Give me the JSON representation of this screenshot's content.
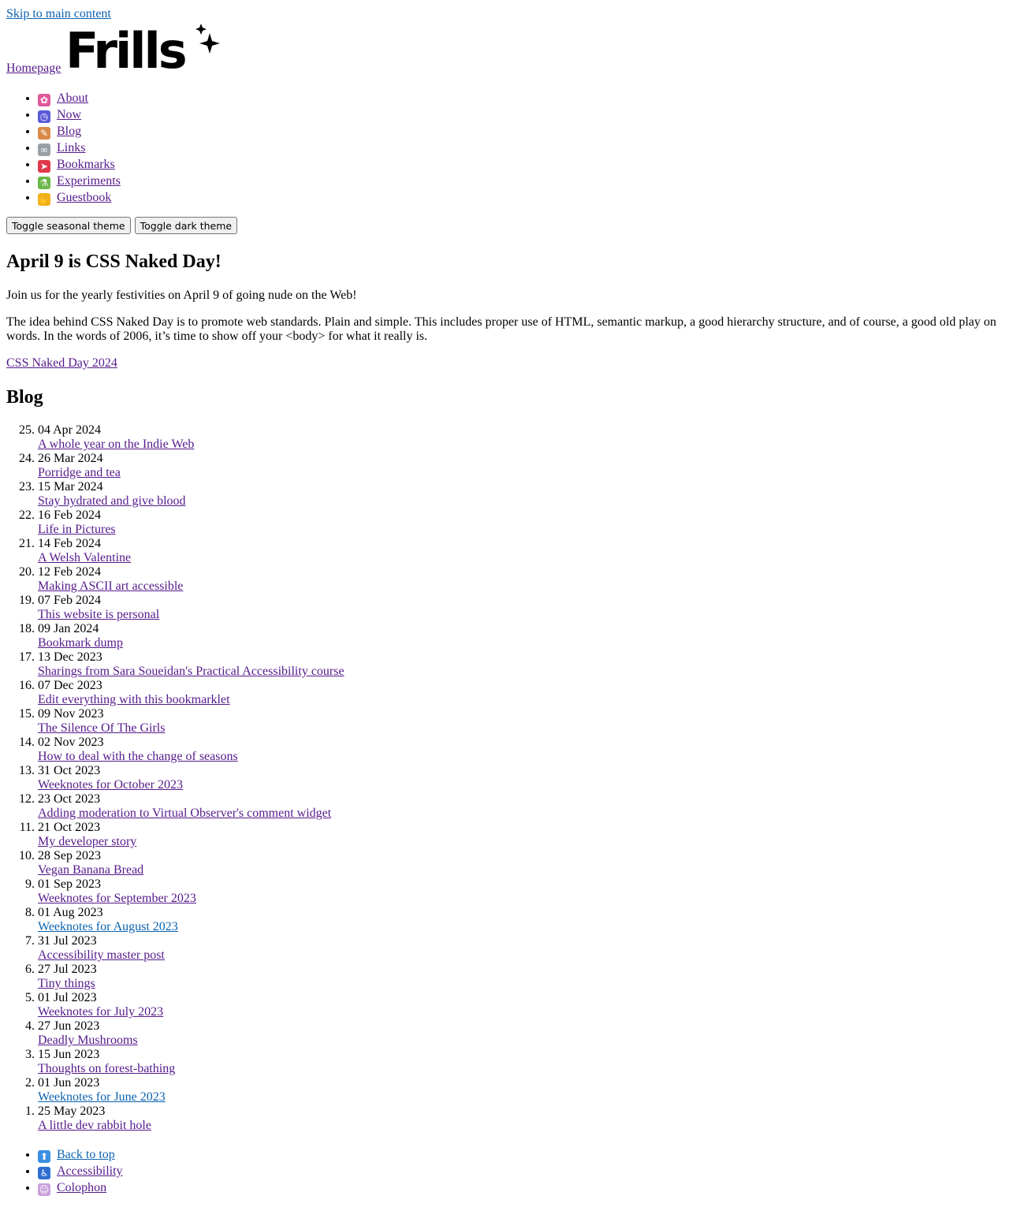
{
  "skip_link": "Skip to main content",
  "home_link": "Homepage",
  "logo_text": "Frills",
  "nav": [
    {
      "label": "About",
      "icon": "tulip-icon",
      "color": "#e05a9b",
      "glyph": "✿"
    },
    {
      "label": "Now",
      "icon": "stopwatch-icon",
      "color": "#5a5ad8",
      "glyph": "◷"
    },
    {
      "label": "Blog",
      "icon": "memo-icon",
      "color": "#d98a4a",
      "glyph": "✎"
    },
    {
      "label": "Links",
      "icon": "link-icon",
      "color": "#9aa0a8",
      "glyph": "∞"
    },
    {
      "label": "Bookmarks",
      "icon": "bookmark-tag-icon",
      "color": "#e0394a",
      "glyph": "➤"
    },
    {
      "label": "Experiments",
      "icon": "test-tube-icon",
      "color": "#6bb84a",
      "glyph": "⚗"
    },
    {
      "label": "Guestbook",
      "icon": "waving-hand-icon",
      "color": "#f1b21a",
      "glyph": "✋"
    }
  ],
  "buttons": {
    "seasonal": "Toggle seasonal theme",
    "dark": "Toggle dark theme"
  },
  "naked_day": {
    "title": "April 9 is CSS Naked Day!",
    "p1": "Join us for the yearly festivities on April 9 of going nude on the Web!",
    "p2": "The idea behind CSS Naked Day is to promote web standards. Plain and simple. This includes proper use of HTML, semantic markup, a good hierarchy structure, and of course, a good old play on words. In the words of 2006, it’s time to show off your <body> for what it really is.",
    "link": "CSS Naked Day 2024"
  },
  "blog": {
    "title": "Blog",
    "posts": [
      {
        "date": "04 Apr 2024",
        "title": "A whole year on the Indie Web"
      },
      {
        "date": "26 Mar 2024",
        "title": "Porridge and tea"
      },
      {
        "date": "15 Mar 2024",
        "title": "Stay hydrated and give blood"
      },
      {
        "date": "16 Feb 2024",
        "title": "Life in Pictures"
      },
      {
        "date": "14 Feb 2024",
        "title": "A Welsh Valentine"
      },
      {
        "date": "12 Feb 2024",
        "title": "Making ASCII art accessible"
      },
      {
        "date": "07 Feb 2024",
        "title": "This website is personal"
      },
      {
        "date": "09 Jan 2024",
        "title": "Bookmark dump"
      },
      {
        "date": "13 Dec 2023",
        "title": "Sharings from Sara Soueidan's Practical Accessibility course"
      },
      {
        "date": "07 Dec 2023",
        "title": "Edit everything with this bookmarklet"
      },
      {
        "date": "09 Nov 2023",
        "title": "The Silence Of The Girls"
      },
      {
        "date": "02 Nov 2023",
        "title": "How to deal with the change of seasons"
      },
      {
        "date": "31 Oct 2023",
        "title": "Weeknotes for October 2023"
      },
      {
        "date": "23 Oct 2023",
        "title": "Adding moderation to Virtual Observer's comment widget"
      },
      {
        "date": "21 Oct 2023",
        "title": "My developer story"
      },
      {
        "date": "28 Sep 2023",
        "title": "Vegan Banana Bread"
      },
      {
        "date": "01 Sep 2023",
        "title": "Weeknotes for September 2023"
      },
      {
        "date": "01 Aug 2023",
        "title": "Weeknotes for August 2023"
      },
      {
        "date": "31 Jul 2023",
        "title": "Accessibility master post"
      },
      {
        "date": "27 Jul 2023",
        "title": "Tiny things"
      },
      {
        "date": "01 Jul 2023",
        "title": "Weeknotes for July 2023"
      },
      {
        "date": "27 Jun 2023",
        "title": "Deadly Mushrooms"
      },
      {
        "date": "15 Jun 2023",
        "title": "Thoughts on forest-bathing"
      },
      {
        "date": "01 Jun 2023",
        "title": "Weeknotes for June 2023"
      },
      {
        "date": "25 May 2023",
        "title": "A little dev rabbit hole"
      }
    ]
  },
  "footer": [
    {
      "label": "Back to top",
      "icon": "up-arrow-icon",
      "color": "#3b8fe0",
      "glyph": "⬆"
    },
    {
      "label": "Accessibility",
      "icon": "wheelchair-icon",
      "color": "#2f6fd0",
      "glyph": "♿"
    },
    {
      "label": "Colophon",
      "icon": "person-at-computer-icon",
      "color": "#c9a0dc",
      "glyph": "☺"
    }
  ],
  "colors": {
    "visited_link": "#551a8b",
    "unvisited_link": "#0a62b0"
  }
}
